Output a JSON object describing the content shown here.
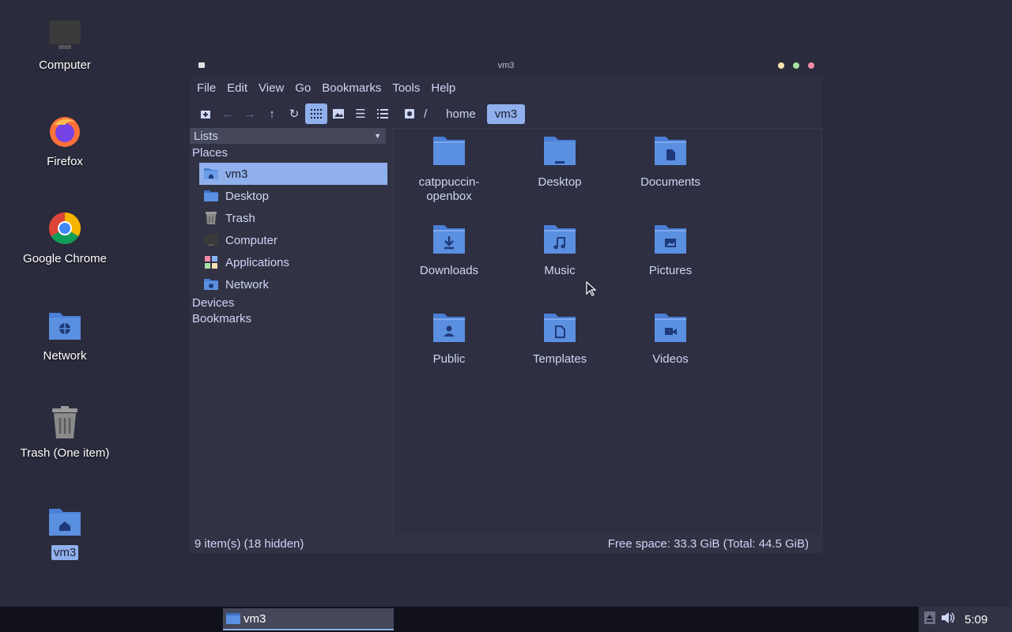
{
  "desktop": {
    "icons": [
      {
        "label": "Computer"
      },
      {
        "label": "Firefox"
      },
      {
        "label": "Google Chrome"
      },
      {
        "label": "Network"
      },
      {
        "label": "Trash (One item)"
      },
      {
        "label": "vm3"
      }
    ]
  },
  "window": {
    "title": "vm3",
    "menu": [
      "File",
      "Edit",
      "View",
      "Go",
      "Bookmarks",
      "Tools",
      "Help"
    ],
    "path": {
      "root": "/",
      "crumbs": [
        "home",
        "vm3"
      ]
    },
    "sidebar": {
      "lists_label": "Lists",
      "places_label": "Places",
      "places": [
        {
          "label": "vm3",
          "icon": "home-folder-icon"
        },
        {
          "label": "Desktop",
          "icon": "desktop-folder-icon"
        },
        {
          "label": "Trash",
          "icon": "trash-icon"
        },
        {
          "label": "Computer",
          "icon": "computer-icon"
        },
        {
          "label": "Applications",
          "icon": "applications-icon"
        },
        {
          "label": "Network",
          "icon": "network-icon"
        }
      ],
      "devices_label": "Devices",
      "bookmarks_label": "Bookmarks"
    },
    "files": [
      {
        "label": "catppuccin-openbox",
        "emblem": "none"
      },
      {
        "label": "Desktop",
        "emblem": "desktop"
      },
      {
        "label": "Documents",
        "emblem": "document"
      },
      {
        "label": "Downloads",
        "emblem": "download"
      },
      {
        "label": "Music",
        "emblem": "music"
      },
      {
        "label": "Pictures",
        "emblem": "picture"
      },
      {
        "label": "Public",
        "emblem": "person"
      },
      {
        "label": "Templates",
        "emblem": "template"
      },
      {
        "label": "Videos",
        "emblem": "video"
      }
    ],
    "status": {
      "left": "9 item(s) (18 hidden)",
      "right": "Free space: 33.3 GiB (Total: 44.5 GiB)"
    }
  },
  "taskbar": {
    "task_label": "vm3",
    "clock": "5:09"
  },
  "colors": {
    "accent": "#8fb0ec",
    "folder": "#5b8fe0",
    "background": "#2a2b3c"
  }
}
